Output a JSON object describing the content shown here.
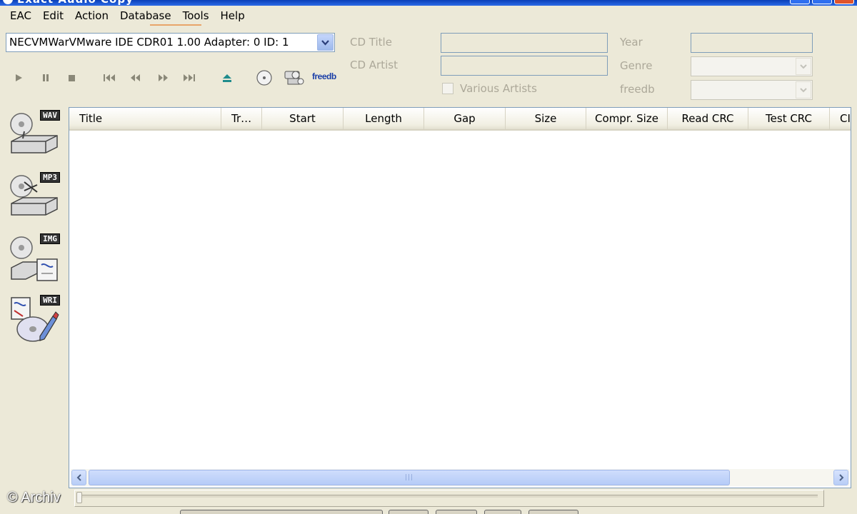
{
  "window": {
    "title": "Exact Audio Copy"
  },
  "menu": {
    "items": [
      "EAC",
      "Edit",
      "Action",
      "Database",
      "Tools",
      "Help"
    ]
  },
  "drive": {
    "selected": "NECVMWarVMware IDE CDR01 1.00  Adapter: 0  ID: 1"
  },
  "toolbar": {
    "buttons": [
      "play-icon",
      "pause-icon",
      "stop-icon",
      "previous-track-icon",
      "rewind-icon",
      "fast-forward-icon",
      "next-track-icon",
      "eject-icon",
      "cd-info-icon",
      "network-icon",
      "freedb-icon"
    ],
    "freedb_label": "freedb"
  },
  "cd_info": {
    "title_label": "CD Title",
    "title_value": "",
    "artist_label": "CD Artist",
    "artist_value": "",
    "various_artists_label": "Various Artists",
    "various_artists_checked": false,
    "year_label": "Year",
    "year_value": "",
    "genre_label": "Genre",
    "genre_value": "",
    "freedb_label": "freedb",
    "freedb_value": ""
  },
  "actions": {
    "items": [
      {
        "tag": "WAV",
        "icon": "copy-to-wav-icon"
      },
      {
        "tag": "MP3",
        "icon": "copy-to-mp3-icon"
      },
      {
        "tag": "IMG",
        "icon": "copy-image-icon"
      },
      {
        "tag": "WRI",
        "icon": "write-cd-icon"
      }
    ]
  },
  "tracklist": {
    "columns": [
      "Title",
      "Tr…",
      "Start",
      "Length",
      "Gap",
      "Size",
      "Compr. Size",
      "Read CRC",
      "Test CRC",
      "CI"
    ],
    "rows": []
  },
  "status": {
    "watermark": "© Archiv"
  },
  "colors": {
    "window_bg": "#ECE9D8",
    "border_blue": "#7F9DB9",
    "accent_orange": "#E8A56A",
    "scroll_blue": "#B5CBF7"
  }
}
